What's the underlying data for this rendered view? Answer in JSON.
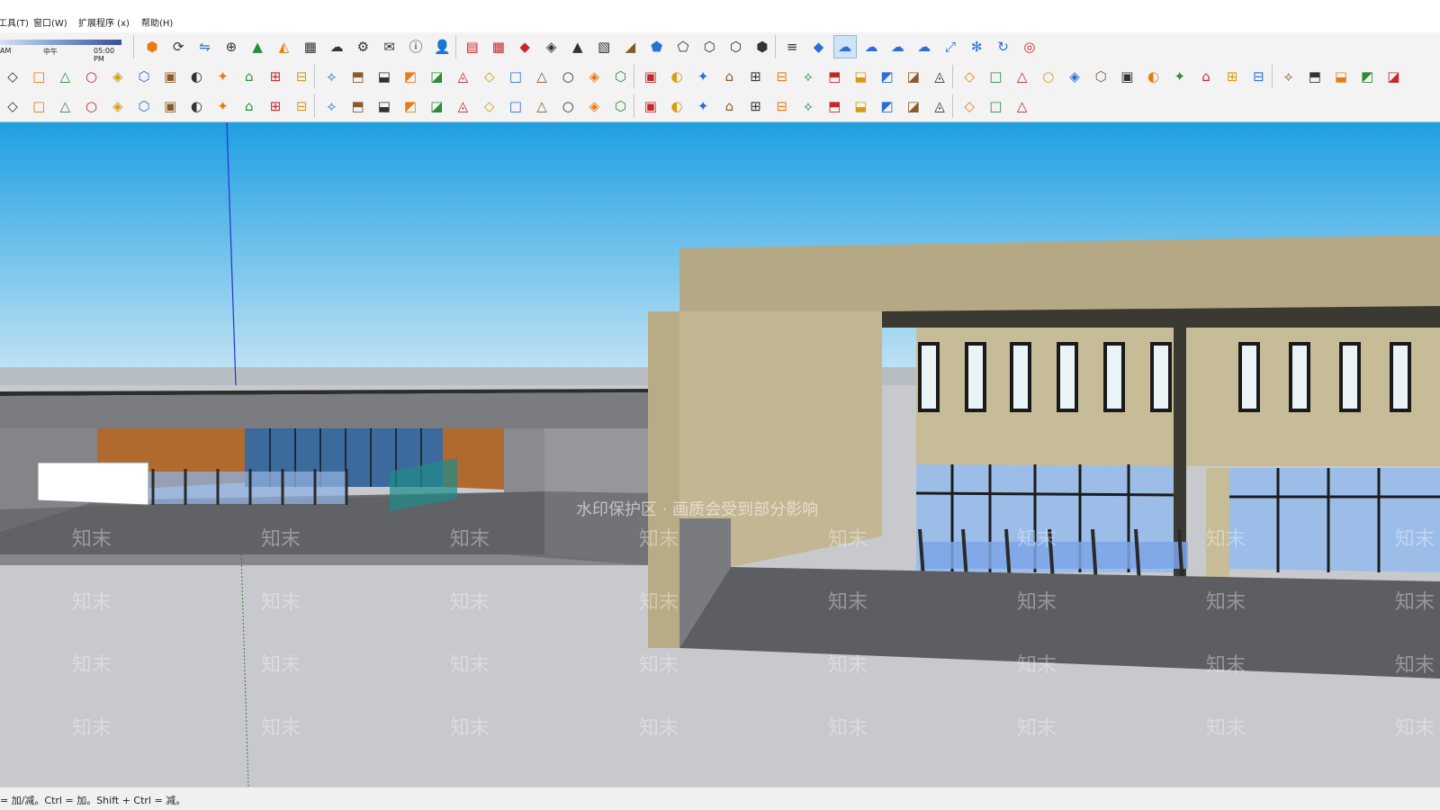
{
  "menubar": {
    "items": [
      "工具(T)",
      "窗口(W)",
      "扩展程序 (x)",
      "帮助(H)"
    ]
  },
  "shadow_timeline": {
    "start": "AM",
    "noon": "中午",
    "end": "05:00 PM"
  },
  "toolbar_icons": {
    "row1": [
      "sketchup-logo-icon",
      "refresh-icon",
      "layers-swap-icon",
      "add-location-icon",
      "tree-icon",
      "terrain-icon",
      "checker-icon",
      "cloud-upload-icon",
      "gear-icon",
      "mail-icon",
      "info-icon",
      "user-icon",
      "book-icon",
      "grid-icon",
      "stamp-icon",
      "smoove-icon",
      "paint-icon",
      "texture-icon",
      "drape-icon",
      "front-face-icon",
      "back-face-icon",
      "face-icon",
      "face-outline-icon",
      "box-icon",
      "stack-icon",
      "cube-blue-icon",
      "cloud-link-icon",
      "cloud-share-icon",
      "cloud-icon",
      "cloud-outline-icon",
      "resize-icon",
      "network-icon",
      "check-cycle-icon",
      "chrome-icon"
    ],
    "row2": [
      "reload-icon",
      "rotate-icon",
      "3d-text-icon",
      "perspective-icon",
      "grid-frame-icon",
      "cylinder-icon",
      "cylinder-outline-icon",
      "stair-icon",
      "stair-alt-icon",
      "figure-icon",
      "circle-arrow-icon",
      "erase-icon",
      "curve-icon",
      "curve-alt-icon",
      "wave-icon",
      "step-icon",
      "arrow-down-red-icon",
      "swap-red-icon",
      "arc-icon",
      "line-icon",
      "wood-icon",
      "box-tool-icon",
      "gear-orange-icon",
      "vase-icon",
      "shield-icon",
      "link-icon",
      "leaf-icon",
      "folder-gold-icon",
      "arrow-up-red-icon",
      "basket-icon",
      "house-3d-icon",
      "box-3d-icon",
      "home-icon",
      "house-icon",
      "house-outline-icon",
      "roof-icon",
      "clipboard-icon",
      "pen-icon",
      "image-icon",
      "photo-icon",
      "bulb-icon",
      "hex-icon",
      "cube-outline-icon",
      "magnifier-icon",
      "settings-icon",
      "tile-orange-icon",
      "tile-grid-icon",
      "tile-red-icon",
      "tile-dark-icon",
      "panel-icon",
      "layers-icon",
      "layers-add-icon",
      "layers-alt-icon"
    ],
    "row3": [
      "undo-icon",
      "polyline-icon",
      "diagonal-icon",
      "compass-icon",
      "branch-icon",
      "cube-gold-icon",
      "cube-gray-icon",
      "cube-purple-icon",
      "bookshelf-icon",
      "plant-icon",
      "stripe-icon",
      "frame-icon",
      "mirror-icon",
      "rotate-x-icon",
      "rotate-y-icon",
      "rotate-z-icon",
      "rotate-r-icon",
      "rotate-v-icon",
      "slice-icon",
      "box-red-icon",
      "box-alt-icon",
      "bridge-icon",
      "curve-blue-icon",
      "corner-icon",
      "s-curve-icon",
      "s-red-icon",
      "pill-icon",
      "pill-half-icon",
      "pill-dark-icon",
      "pill-outline-icon",
      "pill-bold-icon",
      "flower-icon",
      "grid-pink-icon",
      "cube-blue-alt-icon",
      "peak-icon",
      "peak-alt-icon",
      "book-alt-icon",
      "pages-icon",
      "spinner-orange-icon"
    ]
  },
  "viewport": {
    "watermark_banner": "水印保护区 · 画质会受到部分影响",
    "watermark_brand": "知末",
    "sky_top": "#1e9fe2",
    "sky_bottom": "#c9e6f5",
    "ground": "#c8c9cd"
  },
  "status_bar": {
    "hint": "= 加/减。Ctrl = 加。Shift + Ctrl = 减。"
  }
}
